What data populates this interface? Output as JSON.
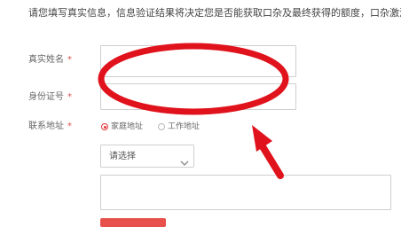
{
  "notice": "请您填写真实信息，信息验证结果将决定您是否能获取口杂及最终获得的额度，口杂激活后",
  "form": {
    "real_name": {
      "label": "真实姓名",
      "required_mark": "*",
      "value": ""
    },
    "id_number": {
      "label": "身份证号",
      "required_mark": "*",
      "value": ""
    },
    "address": {
      "label": "联系地址",
      "required_mark": "*",
      "options": [
        {
          "label": "家庭地址",
          "checked": true
        },
        {
          "label": "工作地址",
          "checked": false
        }
      ],
      "select": {
        "selected": "请选择"
      },
      "detail_value": ""
    },
    "submit_label": ""
  },
  "annotation": {
    "color": "#e0121c",
    "shapes": [
      "ellipse-highlight",
      "arrow"
    ]
  },
  "icons": {
    "chevron": "chevron-down-icon"
  }
}
